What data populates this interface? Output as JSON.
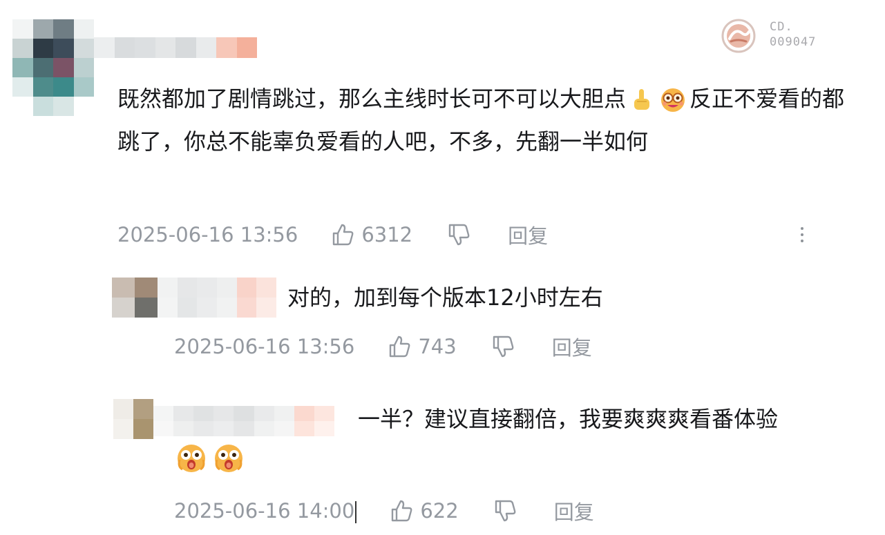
{
  "watermark": {
    "logo_icon": "watermark-logo-icon",
    "code_line1": "CD.",
    "code_line2": "009047"
  },
  "main_comment": {
    "text": "既然都加了剧情跳过，那么主线时长可不可以大胆点",
    "emoji_1": "point-up-icon",
    "emoji_2": "nerd-face-icon",
    "text_after_emoji": "反正不爱看的都跳了，你总不能辜负爱看的人吧，不多，先翻一半如何",
    "time": "2025-06-16 13:56",
    "likes": "6312",
    "reply_label": "回复"
  },
  "replies": [
    {
      "text": "对的，加到每个版本12小时左右",
      "time": "2025-06-16 13:56",
      "likes": "743",
      "reply_label": "回复"
    },
    {
      "text": "一半？建议直接翻倍，我要爽爽爽看番体验",
      "emoji": "shocked-face-icon",
      "time": "2025-06-16 14:00",
      "likes": "622",
      "reply_label": "回复"
    }
  ],
  "colors": {
    "text": "#18191c",
    "meta": "#9499a0",
    "accent": "#c0392b"
  }
}
